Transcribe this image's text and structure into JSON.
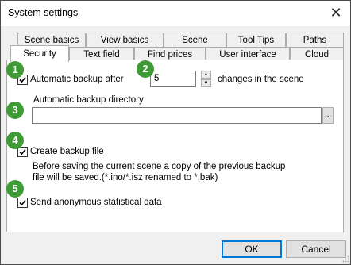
{
  "window": {
    "title": "System settings",
    "close_symbol": "✕"
  },
  "tabs_row1": [
    "Scene basics",
    "View basics",
    "Scene",
    "Tool Tips",
    "Paths"
  ],
  "tabs_row2": [
    "Security",
    "Text field",
    "Find prices",
    "User interface",
    "Cloud"
  ],
  "active_tab": "Security",
  "markers": [
    "1",
    "2",
    "3",
    "4",
    "5"
  ],
  "security": {
    "auto_backup_label": "Automatic backup after",
    "auto_backup_checked": true,
    "backup_count": "5",
    "changes_label": "changes in the scene",
    "dir_label": "Automatic backup directory",
    "dir_value": "",
    "browse_label": "...",
    "create_backup_label": "Create backup file",
    "create_backup_checked": true,
    "create_backup_desc1": "Before saving the current scene a copy of the previous backup",
    "create_backup_desc2": "file will be saved.(*.ino/*.isz renamed to *.bak)",
    "anon_stats_label": "Send anonymous statistical data",
    "anon_stats_checked": true
  },
  "buttons": {
    "ok": "OK",
    "cancel": "Cancel"
  },
  "colors": {
    "marker_green": "#3f9b35",
    "default_button_border": "#0078d7"
  }
}
